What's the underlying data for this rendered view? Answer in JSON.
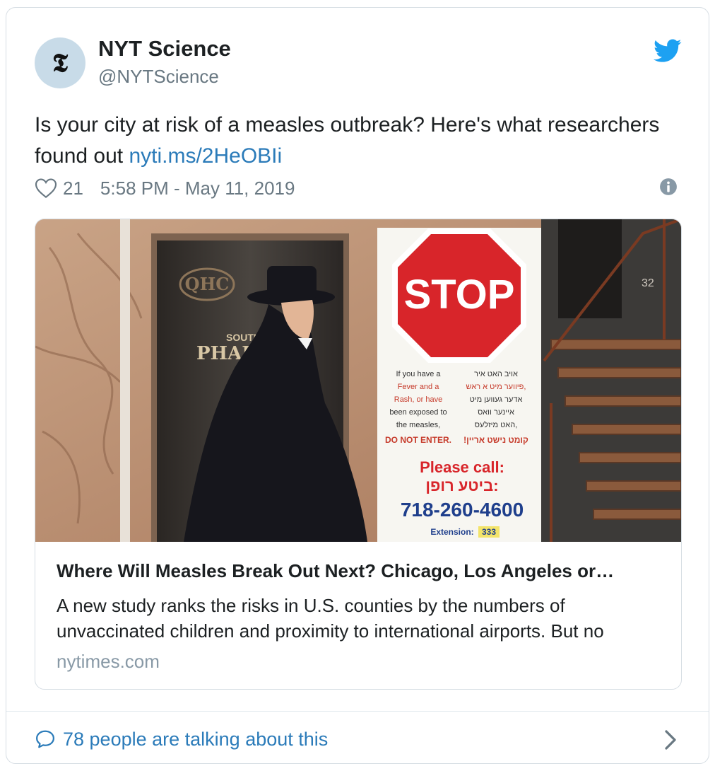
{
  "author": {
    "name": "NYT Science",
    "handle": "@NYTScience",
    "avatar_glyph": "𝕿"
  },
  "icons": {
    "logo": "twitter-bird-icon",
    "like": "heart-icon",
    "info": "info-icon",
    "reply": "speech-bubble-icon",
    "chevron": "chevron-right-icon"
  },
  "tweet": {
    "text": "Is your city at risk of a measles outbreak? Here's what researchers found out ",
    "link": "nyti.ms/2HeOBIi",
    "likes": "21",
    "timestamp": "5:58 PM - May 11, 2019"
  },
  "card": {
    "sign": {
      "stop": "STOP",
      "english": [
        "If you have a",
        "Fever and a",
        "Rash, or have",
        "been exposed to",
        "the measles,"
      ],
      "english_warning": "DO NOT ENTER.",
      "yiddish": [
        "אויב האט איר",
        "פיווער מיט א ראש,",
        "אדער געווען מיט",
        "איינער וואס",
        "האט מיזלעס,"
      ],
      "yiddish_warning": "!קומט נישט אריין",
      "please_call": "Please call:",
      "please_call_yiddish": "ביטע רופן:",
      "phone": "718-260-4600",
      "extension_label": "Extension:",
      "extension": "333",
      "store_logo": "QHC",
      "store_name_1": "SOUTH'S",
      "store_name_2": "PHAR",
      "address_number": "32"
    },
    "title": "Where Will Measles Break Out Next? Chicago, Los Angeles or…",
    "description": "A new study ranks the risks in U.S. counties by the numbers of unvaccinated children and proximity to international airports. But no",
    "domain": "nytimes.com"
  },
  "footer": {
    "label": "78 people are talking about this"
  },
  "colors": {
    "link": "#2b7bb9",
    "twitter_blue": "#1da1f2",
    "muted": "#697882",
    "stop_red": "#d8252a"
  }
}
